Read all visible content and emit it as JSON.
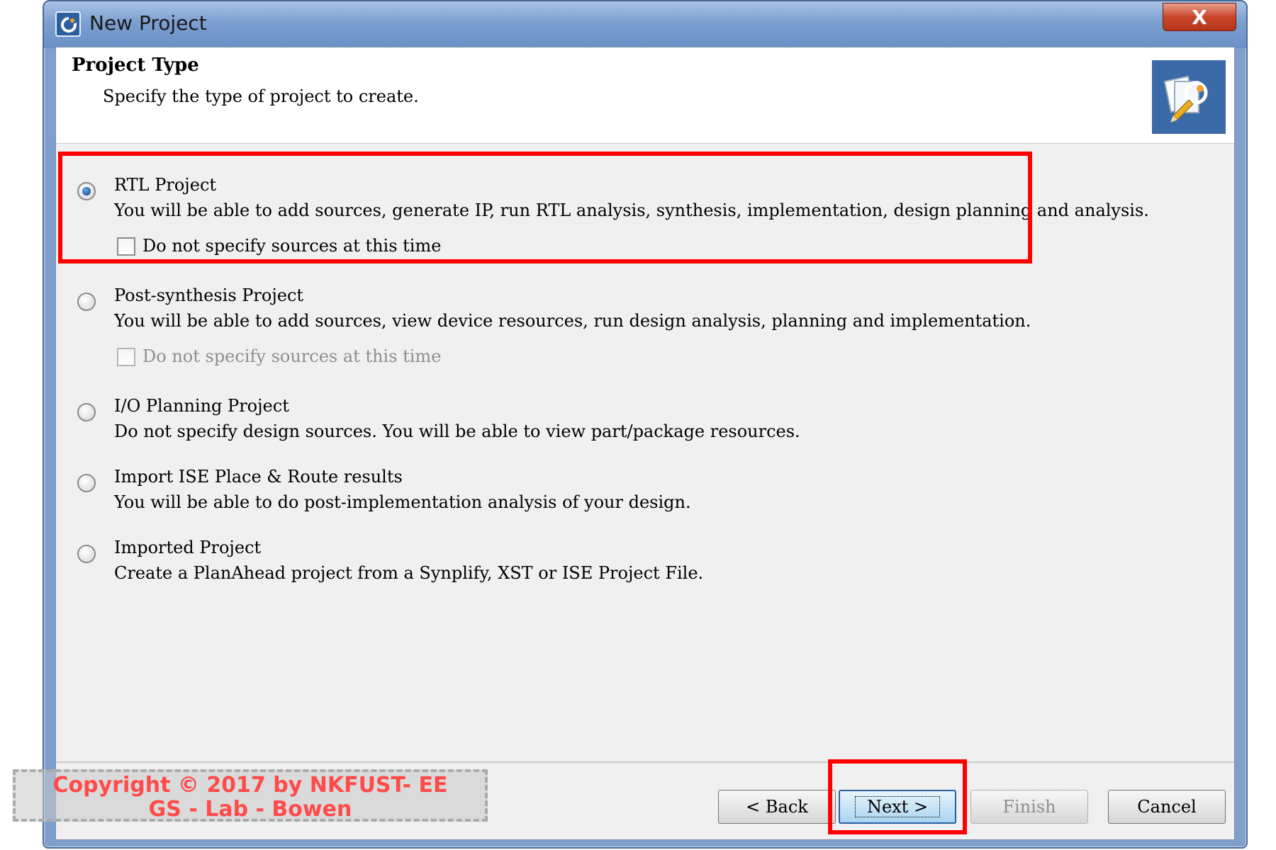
{
  "window": {
    "title": "New Project",
    "close_label": "X"
  },
  "header": {
    "title": "Project Type",
    "subtitle": "Specify the type of project to create."
  },
  "options": [
    {
      "label": "RTL Project",
      "description": "You will be able to add sources, generate IP, run RTL analysis, synthesis, implementation, design planning and analysis.",
      "selected": true,
      "checkbox_label": "Do not specify sources at this time",
      "checkbox_enabled": true
    },
    {
      "label": "Post-synthesis Project",
      "description": "You will be able to add sources, view device resources, run design analysis, planning and implementation.",
      "selected": false,
      "checkbox_label": "Do not specify sources at this time",
      "checkbox_enabled": false
    },
    {
      "label": "I/O Planning Project",
      "description": "Do not specify design sources. You will be able to view part/package resources.",
      "selected": false
    },
    {
      "label": "Import ISE Place & Route results",
      "description": "You will be able to do post-implementation analysis of your design.",
      "selected": false
    },
    {
      "label": "Imported Project",
      "description": "Create a PlanAhead project from a Synplify, XST or ISE Project File.",
      "selected": false
    }
  ],
  "buttons": {
    "back": "< Back",
    "next": "Next >",
    "finish": "Finish",
    "cancel": "Cancel"
  },
  "watermark": {
    "line1": "Copyright © 2017 by NKFUST- EE",
    "line2": "GS - Lab - Bowen"
  },
  "colors": {
    "highlight": "#ff0000",
    "watermark_text": "#ff4a4a"
  }
}
